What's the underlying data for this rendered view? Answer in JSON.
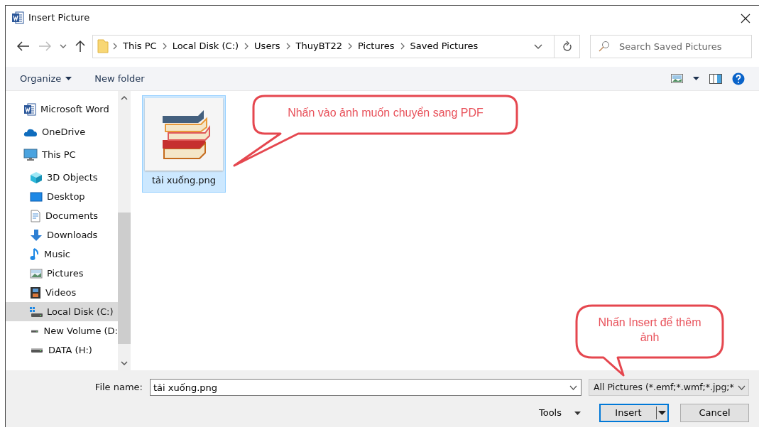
{
  "window": {
    "title": "Insert Picture"
  },
  "address_bar": {
    "path": [
      "This PC",
      "Local Disk (C:)",
      "Users",
      "ThuyBT22",
      "Pictures",
      "Saved Pictures"
    ]
  },
  "search": {
    "placeholder": "Search Saved Pictures"
  },
  "toolbar": {
    "organize": "Organize",
    "new_folder": "New folder"
  },
  "sidebar": {
    "items": [
      {
        "label": "Microsoft Word",
        "kind": "word",
        "selected": false
      },
      {
        "label": "OneDrive",
        "kind": "cloud",
        "selected": false
      },
      {
        "label": "This PC",
        "kind": "pc",
        "selected": false,
        "children": [
          {
            "label": "3D Objects",
            "kind": "cube",
            "selected": false
          },
          {
            "label": "Desktop",
            "kind": "desktop",
            "selected": false
          },
          {
            "label": "Documents",
            "kind": "document",
            "selected": false
          },
          {
            "label": "Downloads",
            "kind": "download",
            "selected": false
          },
          {
            "label": "Music",
            "kind": "music",
            "selected": false
          },
          {
            "label": "Pictures",
            "kind": "pictures",
            "selected": false
          },
          {
            "label": "Videos",
            "kind": "videos",
            "selected": false
          },
          {
            "label": "Local Disk (C:)",
            "kind": "windrive",
            "selected": true
          },
          {
            "label": "New Volume (D:",
            "kind": "drive",
            "selected": false
          },
          {
            "label": "DATA (H:)",
            "kind": "drive",
            "selected": false
          }
        ]
      }
    ]
  },
  "files": [
    {
      "name": "tải xuống.png",
      "selected": true
    }
  ],
  "file_name": {
    "label": "File name:",
    "value": "tải xuống.png"
  },
  "file_type": {
    "value": "All Pictures (*.emf;*.wmf;*.jpg;*"
  },
  "buttons": {
    "tools": "Tools",
    "insert": "Insert",
    "cancel": "Cancel"
  },
  "callouts": [
    {
      "text": "Nhấn vào ảnh muốn chuyển sang PDF"
    },
    {
      "text": "Nhấn Insert để thêm ảnh"
    }
  ]
}
